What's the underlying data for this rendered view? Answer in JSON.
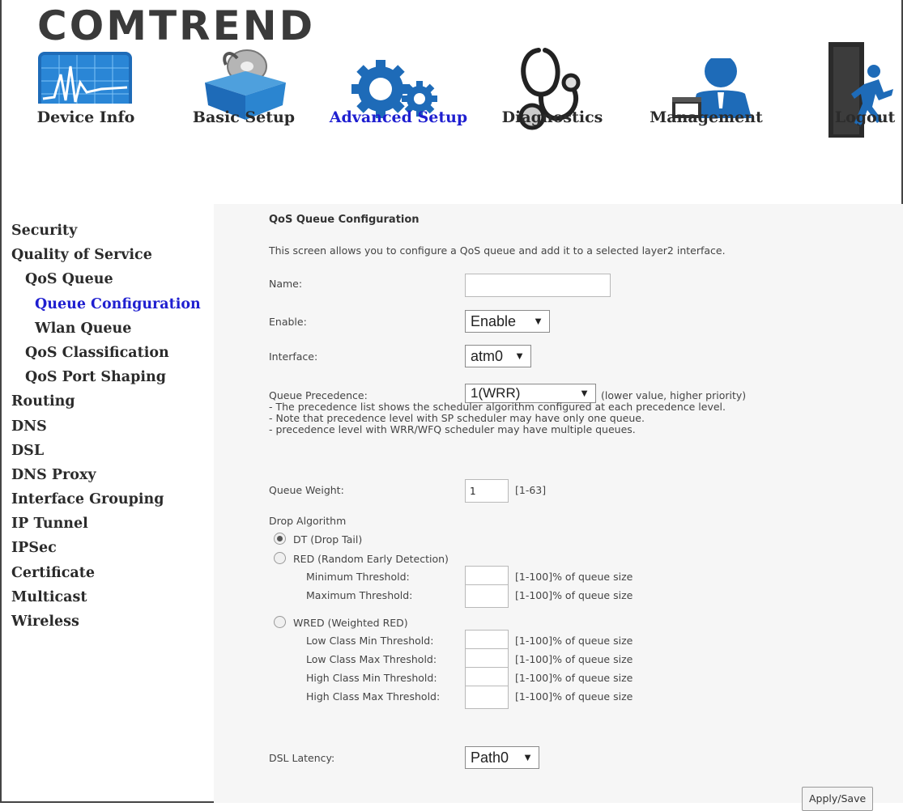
{
  "brand": "COMTREND",
  "nav": [
    {
      "label": "Device Info",
      "icon": "device-info-icon"
    },
    {
      "label": "Basic Setup",
      "icon": "basic-setup-icon"
    },
    {
      "label": "Advanced Setup",
      "icon": "advanced-setup-icon",
      "active": true
    },
    {
      "label": "Diagnostics",
      "icon": "stethoscope-icon"
    },
    {
      "label": "Management",
      "icon": "management-icon"
    },
    {
      "label": "Logout",
      "icon": "logout-icon"
    }
  ],
  "sidebar": [
    {
      "label": "Security"
    },
    {
      "label": "Quality of Service"
    },
    {
      "label": "QoS Queue"
    },
    {
      "label": "Queue Configuration",
      "active": true
    },
    {
      "label": "Wlan Queue"
    },
    {
      "label": "QoS Classification"
    },
    {
      "label": "QoS Port Shaping"
    },
    {
      "label": "Routing"
    },
    {
      "label": "DNS"
    },
    {
      "label": "DSL"
    },
    {
      "label": "DNS Proxy"
    },
    {
      "label": "Interface Grouping"
    },
    {
      "label": "IP Tunnel"
    },
    {
      "label": "IPSec"
    },
    {
      "label": "Certificate"
    },
    {
      "label": "Multicast"
    },
    {
      "label": "Wireless"
    }
  ],
  "form": {
    "title": "QoS Queue Configuration",
    "description": "This screen allows you to configure a QoS queue and add it to a selected layer2 interface.",
    "name_label": "Name:",
    "name_value": "",
    "enable_label": "Enable:",
    "enable_value": "Enable",
    "interface_label": "Interface:",
    "interface_value": "atm0",
    "precedence_label": "Queue Precedence:",
    "precedence_value": "1(WRR)",
    "precedence_hint": "(lower value, higher priority)",
    "precedence_notes": [
      "- The precedence list shows the scheduler algorithm configured at each precedence level.",
      "- Note that precedence level with SP scheduler may have only one queue.",
      "- precedence level with WRR/WFQ scheduler may have multiple queues."
    ],
    "weight_label": "Queue Weight:",
    "weight_value": "1",
    "weight_range": "[1-63]",
    "drop_label": "Drop Algorithm",
    "dt_label": "DT (Drop Tail)",
    "red_label": "RED (Random Early Detection)",
    "red_min_label": "Minimum Threshold:",
    "red_max_label": "Maximum Threshold:",
    "threshold_hint": "[1-100]% of queue size",
    "wred_label": "WRED (Weighted RED)",
    "wred_low_min_label": "Low Class Min Threshold:",
    "wred_low_max_label": "Low Class Max Threshold:",
    "wred_high_min_label": "High Class Min Threshold:",
    "wred_high_max_label": "High Class Max Threshold:",
    "dsl_latency_label": "DSL Latency:",
    "dsl_latency_value": "Path0",
    "apply_label": "Apply/Save"
  }
}
